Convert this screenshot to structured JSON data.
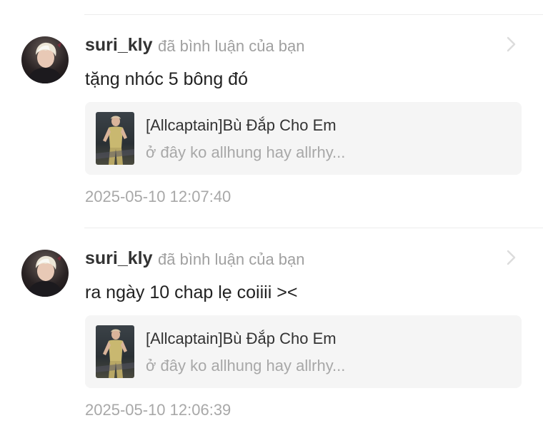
{
  "comments": [
    {
      "username": "suri_kly",
      "action": "đã bình luận của bạn",
      "text": "tặng nhóc 5 bông đó",
      "story": {
        "title": "[Allcaptain]Bù Đắp Cho Em",
        "snippet": "ở đây ko allhung hay allrhy..."
      },
      "time": "2025-05-10 12:07:40"
    },
    {
      "username": "suri_kly",
      "action": "đã bình luận của bạn",
      "text": "ra ngày 10 chap lẹ coiiii ><",
      "story": {
        "title": "[Allcaptain]Bù Đắp Cho Em",
        "snippet": "ở đây ko allhung hay allrhy..."
      },
      "time": "2025-05-10 12:06:39"
    }
  ],
  "icons": {
    "chevron": "chevron-right-icon",
    "avatar": "user-avatar",
    "thumbnail": "story-cover"
  },
  "colors": {
    "username": "#333333",
    "muted": "#a8a8a8",
    "card_bg": "#f5f5f5",
    "divider": "#ececec"
  }
}
